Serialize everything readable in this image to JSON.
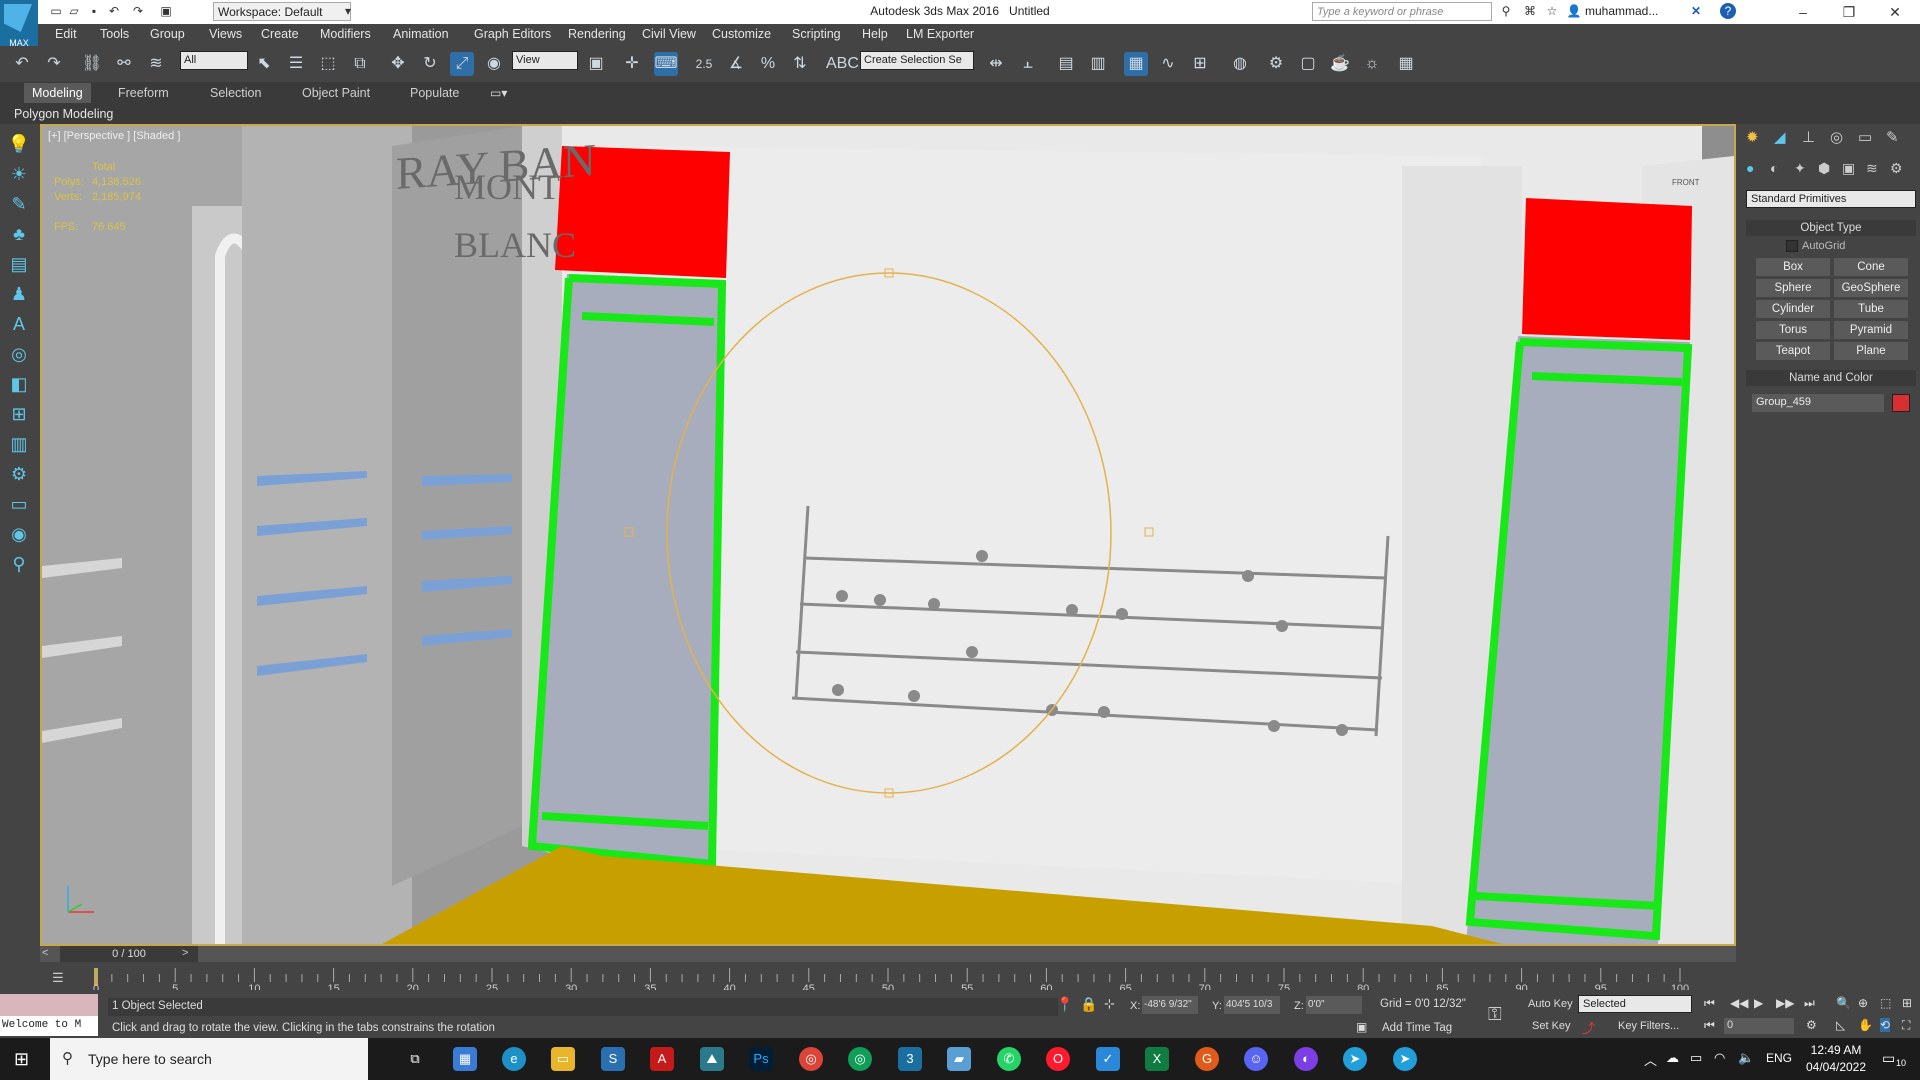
{
  "app": {
    "title": "Autodesk 3ds Max 2016",
    "document": "Untitled",
    "workspace": "Workspace: Default",
    "logo_text": "MAX",
    "search_placeholder": "Type a keyword or phrase",
    "user": "muhammad..."
  },
  "menu": [
    "Edit",
    "Tools",
    "Group",
    "Views",
    "Create",
    "Modifiers",
    "Animation",
    "Graph Editors",
    "Rendering",
    "Civil View",
    "Customize",
    "Scripting",
    "Help",
    "LM Exporter"
  ],
  "toolbar": {
    "filter": "All",
    "ref_coord": "View",
    "snap_value": "2.5",
    "selection_set": "Create Selection Se"
  },
  "ribbon": {
    "tabs": [
      "Modeling",
      "Freeform",
      "Selection",
      "Object Paint",
      "Populate"
    ],
    "active_tab": "Modeling",
    "sub_label": "Polygon Modeling"
  },
  "viewport": {
    "label": "[+] [Perspective ] [Shaded ]",
    "stats": {
      "total_label": "Total",
      "polys_label": "Polys:",
      "polys": "4,138,526",
      "verts_label": "Verts:",
      "verts": "2,185,974",
      "fps_label": "FPS:",
      "fps": "76.645"
    },
    "store_signs": [
      "RAY BAN",
      "MONT BLANC"
    ],
    "viewcube_label": "FRONT",
    "colors": {
      "red": "#ff0000",
      "green": "#18e818",
      "floor": "#c7a000",
      "wall": "#e9e9e9",
      "gizmo": "#e3b24a"
    }
  },
  "command_panel": {
    "category": "Standard Primitives",
    "object_type_header": "Object Type",
    "autogrid": "AutoGrid",
    "buttons": [
      "Box",
      "Cone",
      "Sphere",
      "GeoSphere",
      "Cylinder",
      "Tube",
      "Torus",
      "Pyramid",
      "Teapot",
      "Plane"
    ],
    "name_color_header": "Name and Color",
    "object_name": "Group_459",
    "object_color": "#d83030"
  },
  "timeline": {
    "frame": "0 / 100",
    "ticks": [
      "0",
      "5",
      "10",
      "15",
      "20",
      "25",
      "30",
      "35",
      "40",
      "45",
      "50",
      "55",
      "60",
      "65",
      "70",
      "75",
      "80",
      "85",
      "90",
      "95",
      "100"
    ]
  },
  "status": {
    "maxscript": "Welcome to M",
    "selected": "1 Object Selected",
    "prompt": "Click and drag to rotate the view.  Clicking in the tabs constrains the rotation",
    "x_label": "X:",
    "x": "-48'6 9/32\"",
    "y_label": "Y:",
    "y": "404'5 10/3",
    "z_label": "Z:",
    "z": "0'0\"",
    "grid": "Grid = 0'0 12/32\"",
    "add_time_tag": "Add Time Tag",
    "auto_key": "Auto Key",
    "set_key": "Set Key",
    "key_mode": "Selected",
    "key_filters": "Key Filters...",
    "frame_field": "0"
  },
  "taskbar": {
    "search": "Type here to search",
    "lang": "ENG",
    "time": "12:49 AM",
    "date": "04/04/2022",
    "notifications": "10"
  }
}
